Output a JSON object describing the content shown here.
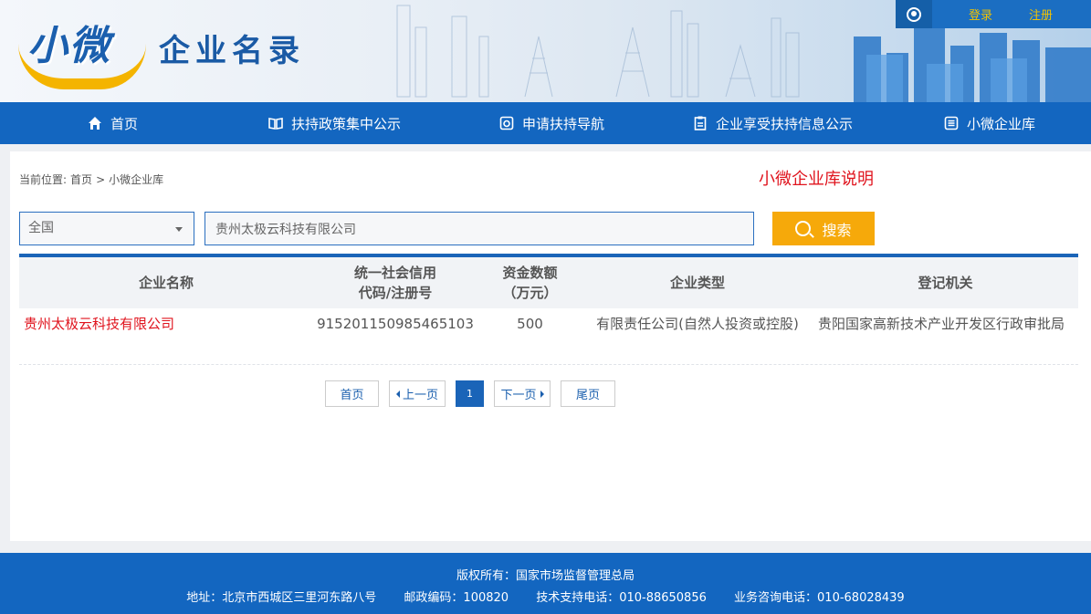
{
  "header": {
    "logo_main": "小微",
    "logo_sub": "企业名录",
    "login": "登录",
    "register": "注册"
  },
  "nav": {
    "items": [
      {
        "label": "首页",
        "icon": "home-icon"
      },
      {
        "label": "扶持政策集中公示",
        "icon": "book-icon"
      },
      {
        "label": "申请扶持导航",
        "icon": "camera-icon"
      },
      {
        "label": "企业享受扶持信息公示",
        "icon": "clipboard-icon"
      },
      {
        "label": "小微企业库",
        "icon": "list-icon"
      }
    ]
  },
  "breadcrumb": {
    "prefix": "当前位置:",
    "home": "首页",
    "separator": ">",
    "current": "小微企业库"
  },
  "desc_link": "小微企业库说明",
  "search": {
    "region": "全国",
    "value": "贵州太极云科技有限公司",
    "button": "搜索"
  },
  "table": {
    "headers": [
      "企业名称",
      "统一社会信用代码/注册号",
      "资金数额(万元)",
      "企业类型",
      "登记机关"
    ],
    "header_lines": {
      "c2a": "统一社会信用",
      "c2b": "代码/注册号",
      "c3a": "资金数额",
      "c3b": "（万元）"
    },
    "rows": [
      {
        "name": "贵州太极云科技有限公司",
        "code": "915201150985465103",
        "capital": "500",
        "type": "有限责任公司(自然人投资或控股)",
        "authority": "贵阳国家高新技术产业开发区行政审批局"
      }
    ]
  },
  "pager": {
    "first": "首页",
    "prev": "上一页",
    "current": "1",
    "next": "下一页",
    "last": "尾页"
  },
  "footer": {
    "copyright": "版权所有：国家市场监督管理总局",
    "address": "地址：北京市西城区三里河东路八号",
    "postcode": "邮政编码：100820",
    "tech": "技术支持电话：010-88650856",
    "consult": "业务咨询电话：010-68028439"
  },
  "colors": {
    "primary": "#1366c0",
    "accent": "#f6a90a",
    "link_red": "#e0141e"
  }
}
